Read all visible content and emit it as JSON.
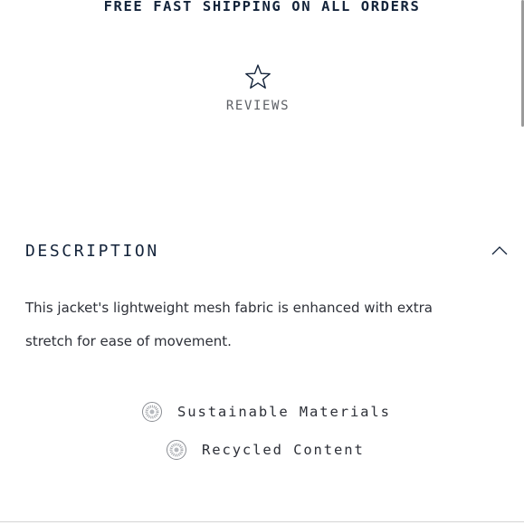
{
  "banner": {
    "shipping_text": "FREE FAST SHIPPING ON ALL ORDERS"
  },
  "reviews": {
    "label": "REVIEWS",
    "icon": "star-outline-icon"
  },
  "description": {
    "title": "DESCRIPTION",
    "toggle_icon": "chevron-up-icon",
    "expanded": true,
    "text": "This jacket's lightweight mesh fabric is enhanced with extra stretch for ease of movement."
  },
  "features": [
    {
      "label": "Sustainable Materials",
      "icon": "sustainability-badge-icon"
    },
    {
      "label": "Recycled Content",
      "icon": "recycled-badge-icon"
    }
  ],
  "colors": {
    "navy": "#13233a",
    "gray_text": "#5d6066",
    "body_text": "#2d3038"
  }
}
